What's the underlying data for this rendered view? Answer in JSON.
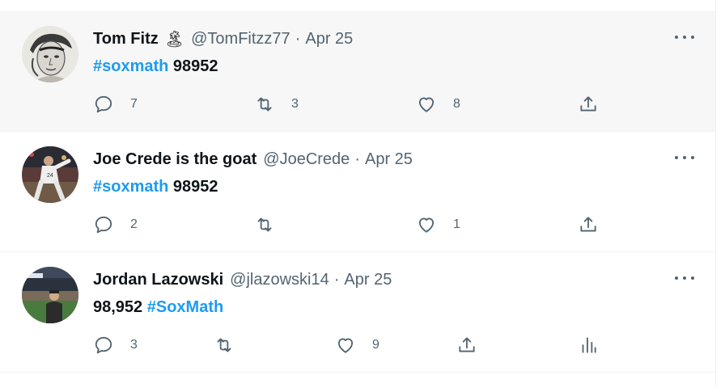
{
  "tweets": [
    {
      "name": "Tom Fitz",
      "emoji": "🏝",
      "handle": "@TomFitzz77",
      "separator": "·",
      "time": "Apr 25",
      "text_parts": [
        {
          "text": "#soxmath",
          "type": "hashtag"
        },
        {
          "text": " 98952",
          "type": "plain"
        }
      ],
      "replies": "7",
      "retweets": "3",
      "likes": "8",
      "avatar_icon": "sketch-portrait-avatar"
    },
    {
      "name": "Joe Crede is the goat",
      "handle": "@JoeCrede",
      "separator": "·",
      "time": "Apr 25",
      "text_parts": [
        {
          "text": "#soxmath",
          "type": "hashtag"
        },
        {
          "text": " 98952",
          "type": "plain"
        }
      ],
      "replies": "2",
      "retweets": "",
      "likes": "1",
      "avatar_icon": "baseball-player-avatar"
    },
    {
      "name": "Jordan Lazowski",
      "handle": "@jlazowski14",
      "separator": "·",
      "time": "Apr 25",
      "text_parts": [
        {
          "text": "98,952 ",
          "type": "plain"
        },
        {
          "text": "#SoxMath",
          "type": "hashtag"
        }
      ],
      "replies": "3",
      "retweets": "",
      "likes": "9",
      "avatar_icon": "stadium-avatar"
    }
  ],
  "colors": {
    "hashtag": "#1d9bf0",
    "secondary_text": "#536471",
    "hover_bg": "#f7f7f7"
  }
}
